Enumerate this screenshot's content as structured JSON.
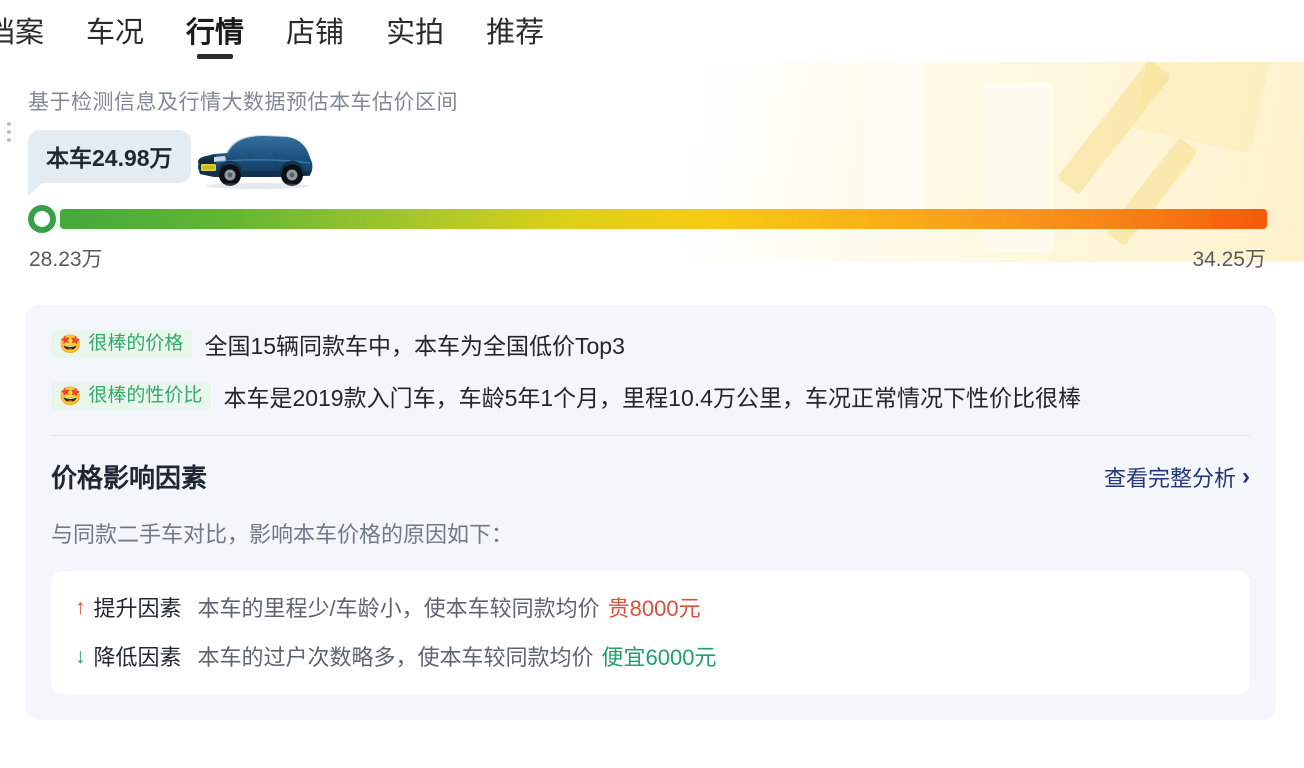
{
  "tabs": [
    {
      "label": "档案",
      "active": false
    },
    {
      "label": "车况",
      "active": false
    },
    {
      "label": "行情",
      "active": true
    },
    {
      "label": "店铺",
      "active": false
    },
    {
      "label": "实拍",
      "active": false
    },
    {
      "label": "推荐",
      "active": false
    }
  ],
  "estimate": {
    "title": "基于检测信息及行情大数据预估本车估价区间",
    "bubble_label": "本车24.98万",
    "car_image_alt": "蓝色SUV车辆图片",
    "range_low": "28.23万",
    "range_high": "34.25万"
  },
  "highlights": [
    {
      "badge_emoji": "🤩",
      "badge_text": "很棒的价格",
      "text": "全国15辆同款车中，本车为全国低价Top3"
    },
    {
      "badge_emoji": "🤩",
      "badge_text": "很棒的性价比",
      "text": "本车是2019款入门车，车龄5年1个月，里程10.4万公里，车况正常情况下性价比很棒"
    }
  ],
  "factors": {
    "title": "价格影响因素",
    "link_label": "查看完整分析",
    "link_chevron": "›",
    "subtitle": "与同款二手车对比，影响本车价格的原因如下：",
    "rows": [
      {
        "arrow": "↑",
        "direction": "up",
        "label": "提升因素",
        "desc_prefix": "本车的里程少/车龄小，使本车较同款均价",
        "amount": "贵8000元"
      },
      {
        "arrow": "↓",
        "direction": "down",
        "label": "降低因素",
        "desc_prefix": "本车的过户次数略多，使本车较同款均价",
        "amount": "便宜6000元"
      }
    ]
  },
  "colors": {
    "accent_green": "#35a96a",
    "accent_red": "#d9503f",
    "link_navy": "#26357a",
    "bar_start": "#46a83c",
    "bar_end": "#f4590a",
    "panel_bg": "#f3f6fa",
    "bubble_bg": "#e3ecf2"
  }
}
